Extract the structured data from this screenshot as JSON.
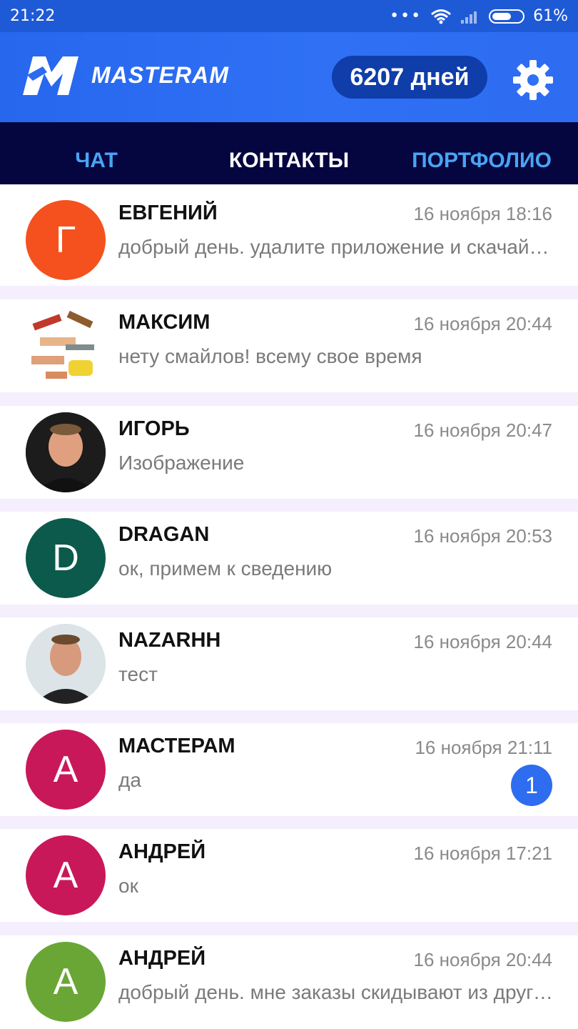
{
  "status_bar": {
    "time": "21:22",
    "battery_percent": "61%",
    "battery_level": 0.61
  },
  "header": {
    "logo_text": "MASTERAM",
    "days_label": "6207 дней",
    "settings_icon": "gear-icon",
    "bg_color": "#2b6bf2"
  },
  "tabs": [
    {
      "label": "ЧАТ",
      "active": false
    },
    {
      "label": "КОНТАКТЫ",
      "active": true
    },
    {
      "label": "ПОРТФОЛИО",
      "active": false
    }
  ],
  "contacts": [
    {
      "name": "ЕВГЕНИЙ",
      "time": "16 ноября 18:16",
      "message": "добрый день. удалите приложение  и скачайте его снова",
      "avatar_letter": "Г",
      "avatar_color": "#f4511e"
    },
    {
      "name": "МАКСИМ",
      "time": "16 ноября 20:44",
      "message": "нету смайлов! всему свое время",
      "avatar_letter": "",
      "avatar_color": "#ffffff",
      "avatar_type": "photo-tools"
    },
    {
      "name": "ИГОРЬ",
      "time": "16 ноября 20:47",
      "message": "Изображение",
      "avatar_letter": "",
      "avatar_color": "#1a1a1a",
      "avatar_type": "photo-person"
    },
    {
      "name": "DRAGAN",
      "time": "16 ноября 20:53",
      "message": "ок, примем к сведению",
      "avatar_letter": "D",
      "avatar_color": "#0b5a4b"
    },
    {
      "name": "NAZARHH",
      "time": "16 ноября 20:44",
      "message": "тест",
      "avatar_letter": "",
      "avatar_color": "#dfe6ea",
      "avatar_type": "photo-person"
    },
    {
      "name": "МАСТЕРАМ",
      "time": "16 ноября 21:11",
      "message": "да",
      "avatar_letter": "A",
      "avatar_color": "#c8185a",
      "unread": "1"
    },
    {
      "name": "АНДРЕЙ",
      "time": "16 ноября 17:21",
      "message": "ок",
      "avatar_letter": "A",
      "avatar_color": "#c8185a"
    },
    {
      "name": "АНДРЕЙ",
      "time": "16 ноября 20:44",
      "message": "добрый день. мне заказы скидывают из другого города",
      "avatar_letter": "A",
      "avatar_color": "#6aa636"
    }
  ]
}
